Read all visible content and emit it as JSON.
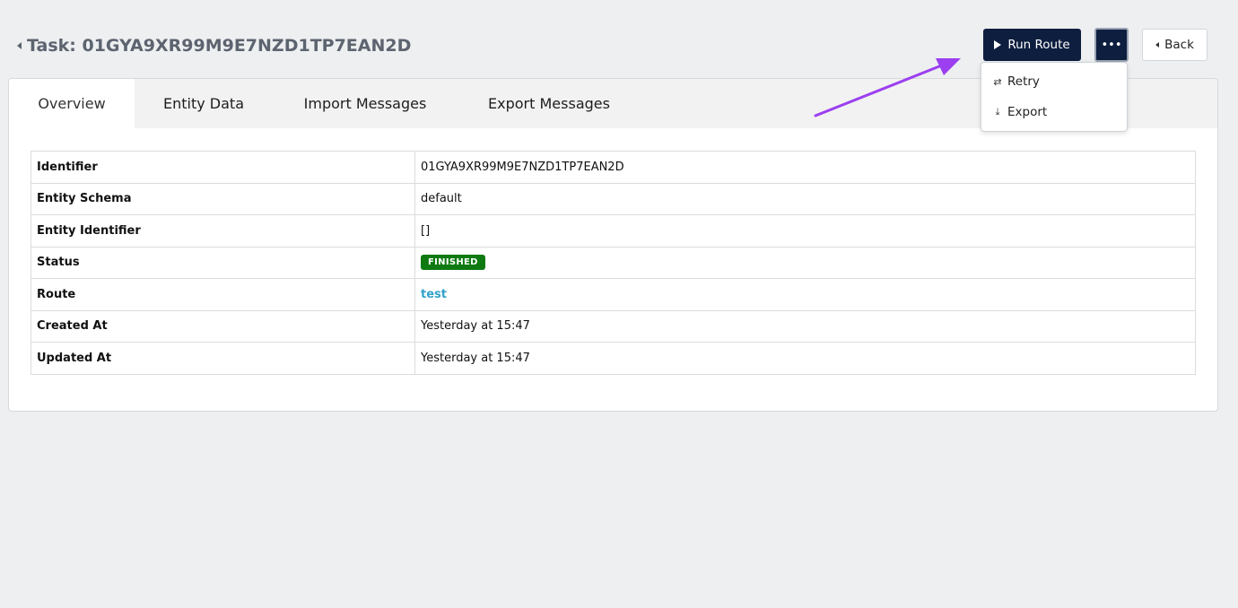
{
  "header": {
    "title": "Task: 01GYA9XR99M9E7NZD1TP7EAN2D",
    "run_route_label": "Run Route",
    "more_label": "•••",
    "back_label": "Back"
  },
  "dropdown": {
    "items": [
      {
        "label": "Retry",
        "icon": "retry-icon"
      },
      {
        "label": "Export",
        "icon": "download-icon"
      }
    ]
  },
  "tabs": [
    {
      "label": "Overview",
      "active": true
    },
    {
      "label": "Entity Data",
      "active": false
    },
    {
      "label": "Import Messages",
      "active": false
    },
    {
      "label": "Export Messages",
      "active": false
    }
  ],
  "details": {
    "rows": [
      {
        "label": "Identifier",
        "value": "01GYA9XR99M9E7NZD1TP7EAN2D"
      },
      {
        "label": "Entity Schema",
        "value": "default"
      },
      {
        "label": "Entity Identifier",
        "value": "[]"
      },
      {
        "label": "Status",
        "value": "FINISHED"
      },
      {
        "label": "Route",
        "value": "test"
      },
      {
        "label": "Created At",
        "value": "Yesterday at 15:47"
      },
      {
        "label": "Updated At",
        "value": "Yesterday at 15:47"
      }
    ]
  },
  "colors": {
    "primary": "#0e1e3f",
    "status_finished": "#0f7a12",
    "link": "#31a2c9",
    "annotation_arrow": "#9b3ff0"
  }
}
